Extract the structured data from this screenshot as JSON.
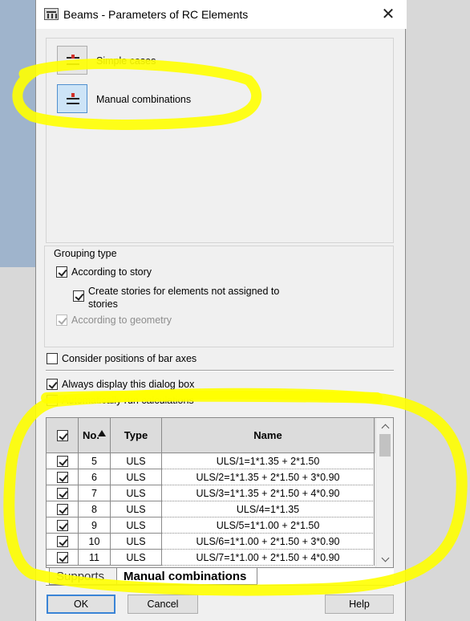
{
  "window": {
    "title": "Beams - Parameters of RC Elements"
  },
  "cases": [
    {
      "label": "Simple cases",
      "selected": false
    },
    {
      "label": "Manual combinations",
      "selected": true
    }
  ],
  "grouping": {
    "legend": "Grouping type",
    "according_to_story": "According to story",
    "create_stories": "Create stories for elements not assigned to stories",
    "according_to_geometry": "According to geometry"
  },
  "options": {
    "consider_positions": "Consider positions of bar axes",
    "always_display": "Always display this dialog box",
    "auto_run": "Automatically run calculations"
  },
  "table": {
    "columns": [
      "No.",
      "Type",
      "Name"
    ],
    "rows": [
      {
        "no": "5",
        "type": "ULS",
        "name": "ULS/1=1*1.35 + 2*1.50"
      },
      {
        "no": "6",
        "type": "ULS",
        "name": "ULS/2=1*1.35 + 2*1.50 + 3*0.90"
      },
      {
        "no": "7",
        "type": "ULS",
        "name": "ULS/3=1*1.35 + 2*1.50 + 4*0.90"
      },
      {
        "no": "8",
        "type": "ULS",
        "name": "ULS/4=1*1.35"
      },
      {
        "no": "9",
        "type": "ULS",
        "name": "ULS/5=1*1.00 + 2*1.50"
      },
      {
        "no": "10",
        "type": "ULS",
        "name": "ULS/6=1*1.00 + 2*1.50 + 3*0.90"
      },
      {
        "no": "11",
        "type": "ULS",
        "name": "ULS/7=1*1.00 + 2*1.50 + 4*0.90"
      }
    ]
  },
  "tabs": [
    "Supports",
    "Manual combinations"
  ],
  "buttons": {
    "ok": "OK",
    "cancel": "Cancel",
    "help": "Help"
  },
  "colors": {
    "highlight": "#ffff00",
    "selection": "#cde4f7"
  }
}
